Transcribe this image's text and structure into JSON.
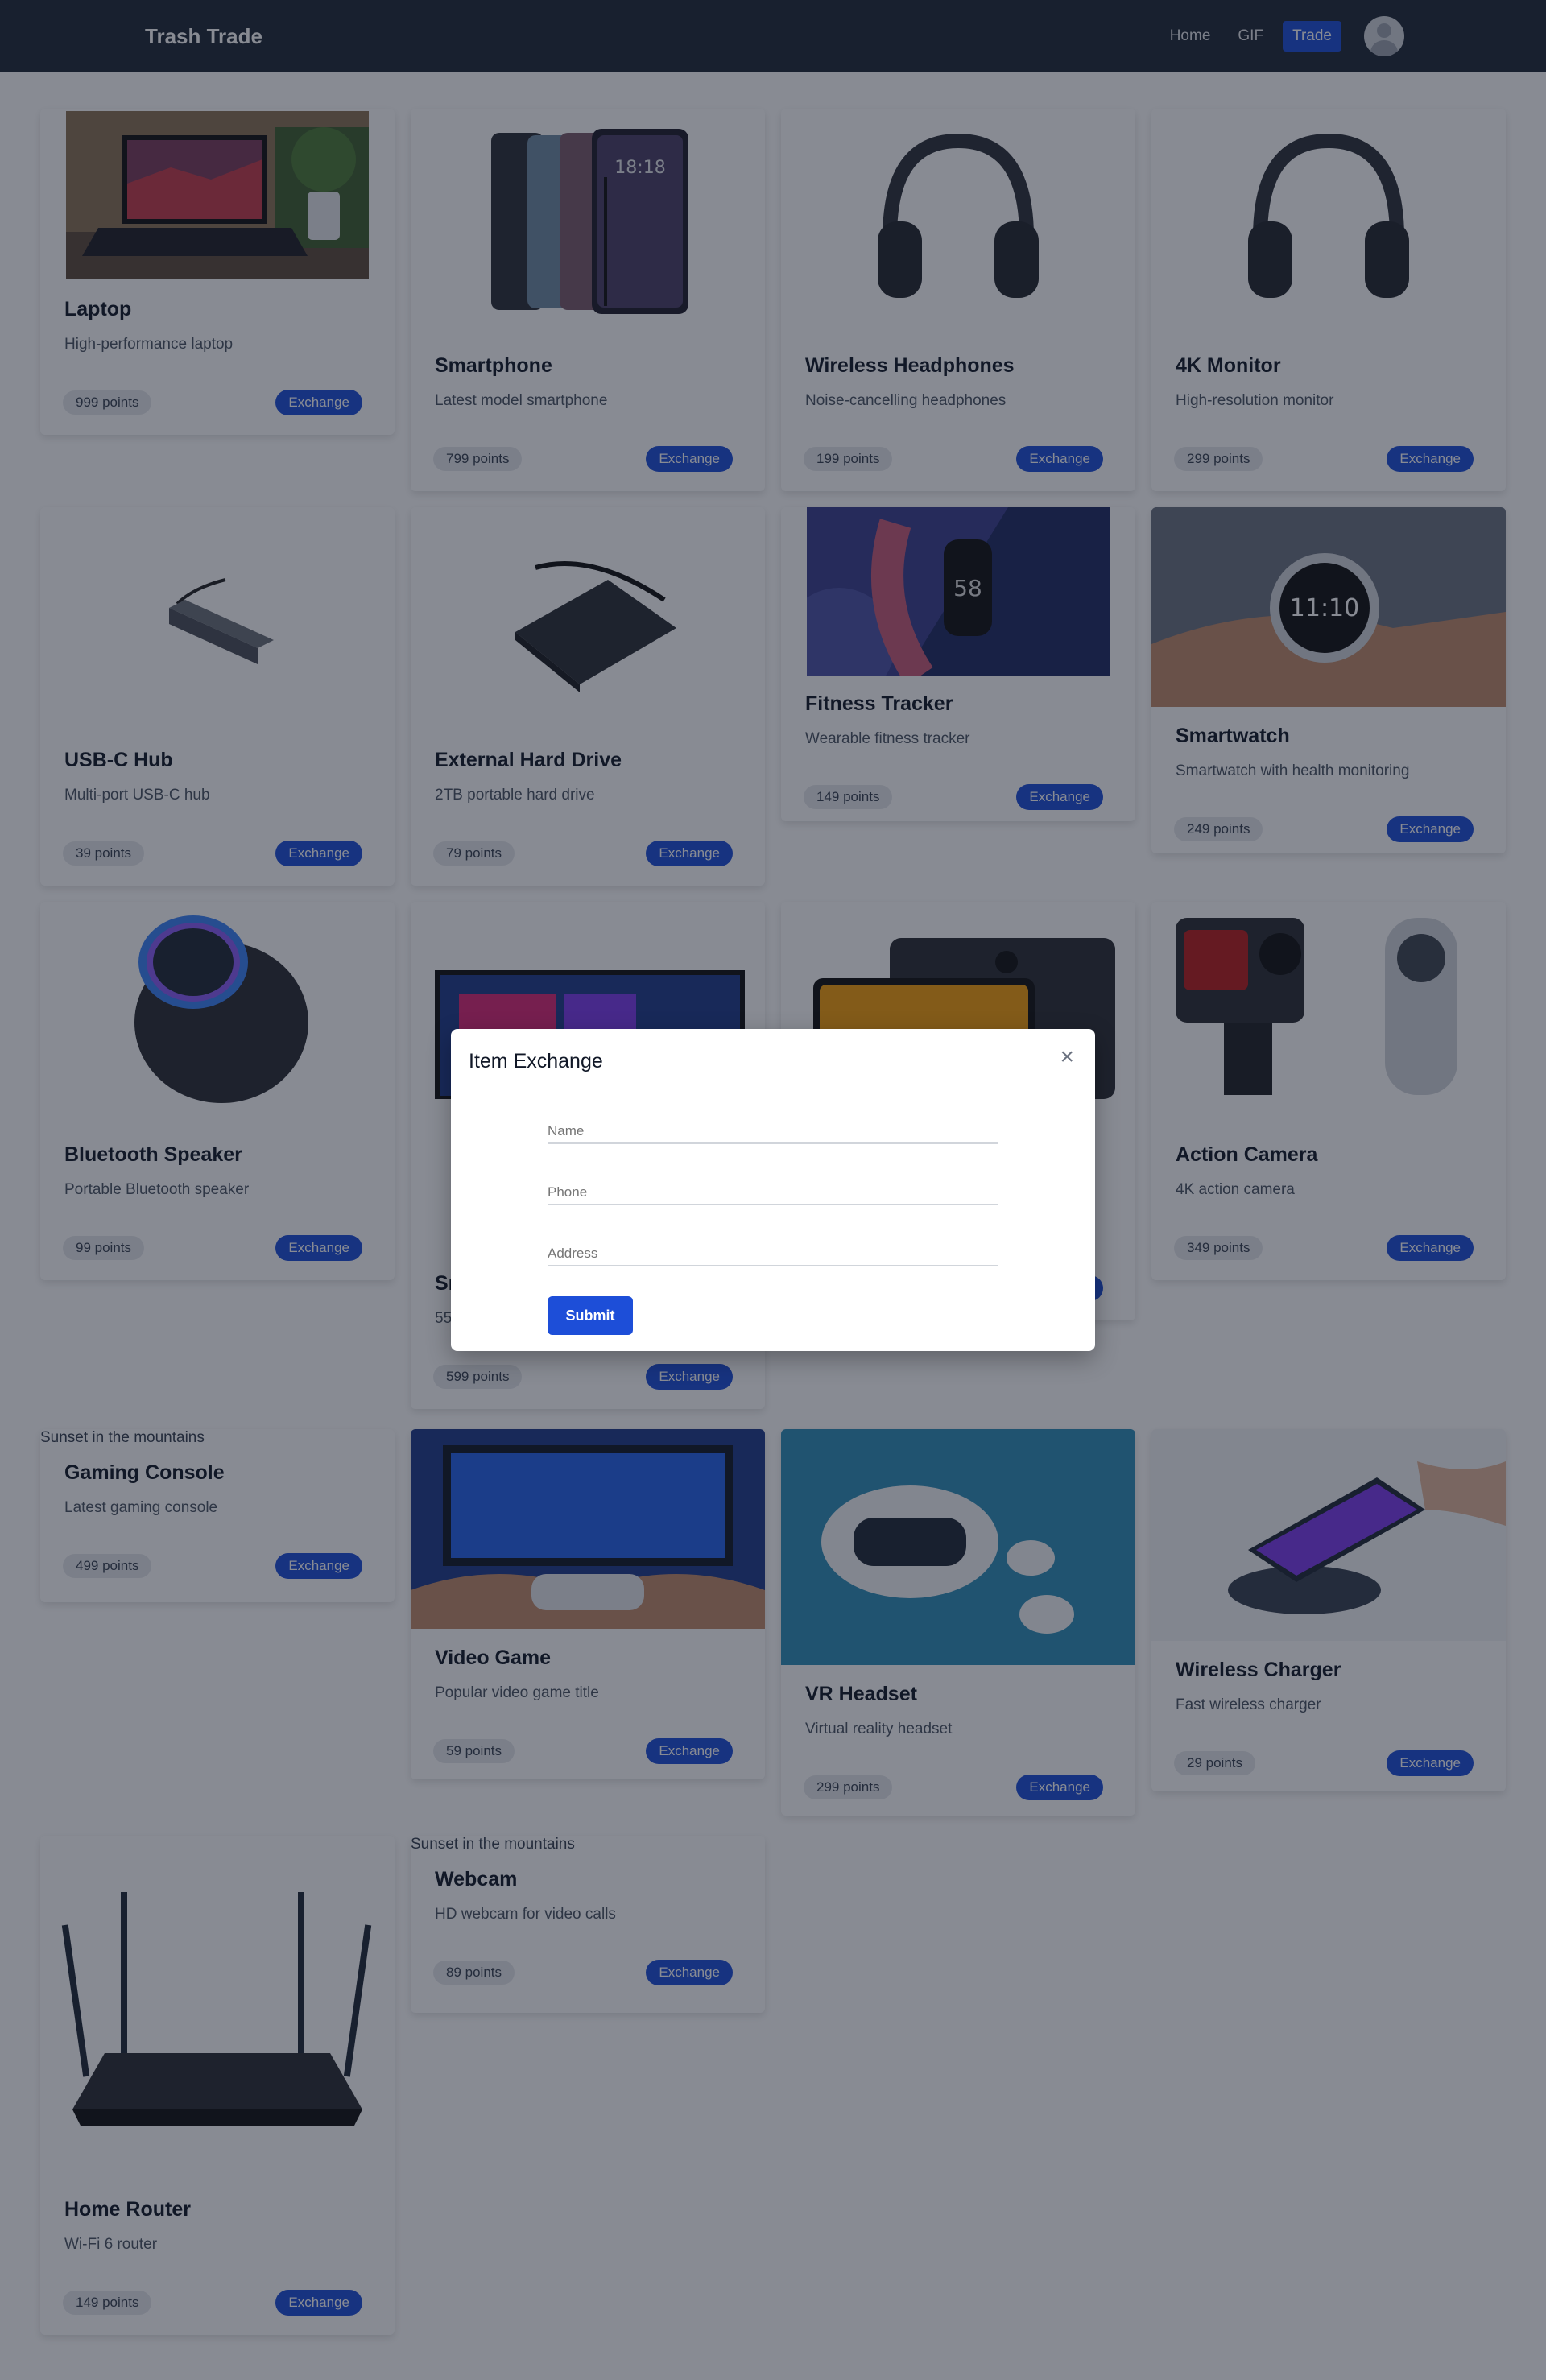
{
  "navbar": {
    "brand": "Trash Trade",
    "links": [
      {
        "label": "Home"
      },
      {
        "label": "GIF"
      },
      {
        "label": "Trade"
      }
    ]
  },
  "products": [
    {
      "title": "Laptop",
      "description": "High-performance laptop",
      "points": "999 points",
      "button": "Exchange"
    },
    {
      "title": "Smartphone",
      "description": "Latest model smartphone",
      "points": "799 points",
      "button": "Exchange"
    },
    {
      "title": "Wireless Headphones",
      "description": "Noise-cancelling headphones",
      "points": "199 points",
      "button": "Exchange"
    },
    {
      "title": "4K Monitor",
      "description": "High-resolution monitor",
      "points": "299 points",
      "button": "Exchange"
    },
    {
      "title": "USB-C Hub",
      "description": "Multi-port USB-C hub",
      "points": "39 points",
      "button": "Exchange"
    },
    {
      "title": "External Hard Drive",
      "description": "2TB portable hard drive",
      "points": "79 points",
      "button": "Exchange"
    },
    {
      "title": "Fitness Tracker",
      "description": "Wearable fitness tracker",
      "points": "149 points",
      "button": "Exchange"
    },
    {
      "title": "Smartwatch",
      "description": "Smartwatch with health monitoring",
      "points": "249 points",
      "button": "Exchange"
    },
    {
      "title": "Bluetooth Speaker",
      "description": "Portable Bluetooth speaker",
      "points": "99 points",
      "button": "Exchange"
    },
    {
      "title": "Sı",
      "description": "55",
      "points": "599 points",
      "button": "Exchange"
    },
    {
      "title": "",
      "description": "",
      "points": "",
      "button": ""
    },
    {
      "title": "Action Camera",
      "description": "4K action camera",
      "points": "349 points",
      "button": "Exchange"
    },
    {
      "title": "Gaming Console",
      "description": "Latest gaming console",
      "points": "499 points",
      "button": "Exchange",
      "image_alt": "Sunset in the mountains"
    },
    {
      "title": "Video Game",
      "description": "Popular video game title",
      "points": "59 points",
      "button": "Exchange"
    },
    {
      "title": "VR Headset",
      "description": "Virtual reality headset",
      "points": "299 points",
      "button": "Exchange"
    },
    {
      "title": "Wireless Charger",
      "description": "Fast wireless charger",
      "points": "29 points",
      "button": "Exchange"
    },
    {
      "title": "Home Router",
      "description": "Wi-Fi 6 router",
      "points": "149 points",
      "button": "Exchange"
    },
    {
      "title": "Webcam",
      "description": "HD webcam for video calls",
      "points": "89 points",
      "button": "Exchange",
      "image_alt": "Sunset in the mountains"
    }
  ],
  "modal": {
    "title": "Item Exchange",
    "close_icon": "close-icon",
    "name_placeholder": "Name",
    "phone_placeholder": "Phone",
    "address_placeholder": "Address",
    "submit_label": "Submit"
  },
  "icons": {
    "avatar": "user-avatar-icon"
  },
  "colors": {
    "navbar": "#1f2937",
    "accent": "#1d4ed8",
    "overlay": "rgba(17,24,39,0.5)"
  }
}
